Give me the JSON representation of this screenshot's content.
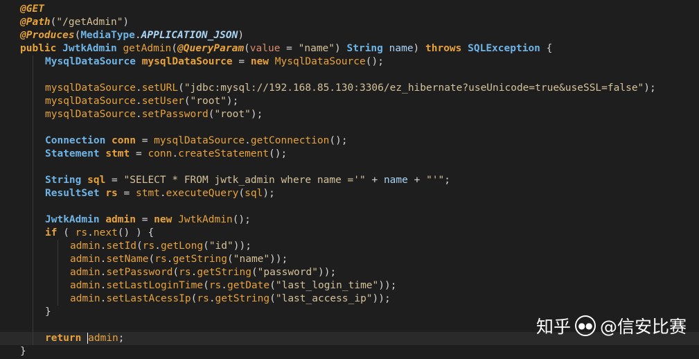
{
  "code": {
    "lines": [
      {
        "indent": 0,
        "tokens": [
          [
            "ann",
            "@GET"
          ]
        ]
      },
      {
        "indent": 0,
        "tokens": [
          [
            "ann",
            "@Path"
          ],
          [
            "pun",
            "("
          ],
          [
            "str",
            "\"/getAdmin\""
          ],
          [
            "pun",
            ")"
          ]
        ]
      },
      {
        "indent": 0,
        "tokens": [
          [
            "ann",
            "@Produces"
          ],
          [
            "pun",
            "("
          ],
          [
            "typ",
            "MediaType"
          ],
          [
            "pun",
            "."
          ],
          [
            "const",
            "APPLICATION_JSON"
          ],
          [
            "pun",
            ")"
          ]
        ]
      },
      {
        "indent": 0,
        "tokens": [
          [
            "kw",
            "public"
          ],
          [
            "plain",
            " "
          ],
          [
            "typ",
            "JwtkAdmin"
          ],
          [
            "plain",
            " "
          ],
          [
            "fn",
            "getAdmin"
          ],
          [
            "pun",
            "("
          ],
          [
            "ann",
            "@QueryParam"
          ],
          [
            "pun",
            "("
          ],
          [
            "param",
            "value"
          ],
          [
            "plain",
            " = "
          ],
          [
            "str",
            "\"name\""
          ],
          [
            "pun",
            ")"
          ],
          [
            "plain",
            " "
          ],
          [
            "typ",
            "String"
          ],
          [
            "plain",
            " "
          ],
          [
            "pvar",
            "name"
          ],
          [
            "pun",
            ")"
          ],
          [
            "plain",
            " "
          ],
          [
            "kw",
            "throws"
          ],
          [
            "plain",
            " "
          ],
          [
            "typ",
            "SQLException"
          ],
          [
            "plain",
            " {"
          ]
        ]
      },
      {
        "indent": 1,
        "tokens": [
          [
            "typ",
            "MysqlDataSource"
          ],
          [
            "plain",
            " "
          ],
          [
            "var",
            "mysqlDataSource"
          ],
          [
            "plain",
            " = "
          ],
          [
            "kw",
            "new"
          ],
          [
            "plain",
            " "
          ],
          [
            "fn",
            "MysqlDataSource"
          ],
          [
            "pun",
            "();"
          ]
        ]
      },
      {
        "indent": 0,
        "tokens": []
      },
      {
        "indent": 1,
        "tokens": [
          [
            "fn",
            "mysqlDataSource"
          ],
          [
            "pun",
            "."
          ],
          [
            "fn",
            "setURL"
          ],
          [
            "pun",
            "("
          ],
          [
            "str",
            "\"jdbc:mysql://192.168.85.130:3306/ez_hibernate?useUnicode=true&useSSL=false\""
          ],
          [
            "pun",
            ");"
          ]
        ]
      },
      {
        "indent": 1,
        "tokens": [
          [
            "fn",
            "mysqlDataSource"
          ],
          [
            "pun",
            "."
          ],
          [
            "fn",
            "setUser"
          ],
          [
            "pun",
            "("
          ],
          [
            "str",
            "\"root\""
          ],
          [
            "pun",
            ");"
          ]
        ]
      },
      {
        "indent": 1,
        "tokens": [
          [
            "fn",
            "mysqlDataSource"
          ],
          [
            "pun",
            "."
          ],
          [
            "fn",
            "setPassword"
          ],
          [
            "pun",
            "("
          ],
          [
            "str",
            "\"root\""
          ],
          [
            "pun",
            ");"
          ]
        ]
      },
      {
        "indent": 0,
        "tokens": []
      },
      {
        "indent": 1,
        "tokens": [
          [
            "typ",
            "Connection"
          ],
          [
            "plain",
            " "
          ],
          [
            "var",
            "conn"
          ],
          [
            "plain",
            " = "
          ],
          [
            "fn",
            "mysqlDataSource"
          ],
          [
            "pun",
            "."
          ],
          [
            "fn",
            "getConnection"
          ],
          [
            "pun",
            "();"
          ]
        ]
      },
      {
        "indent": 1,
        "tokens": [
          [
            "typ",
            "Statement"
          ],
          [
            "plain",
            " "
          ],
          [
            "var",
            "stmt"
          ],
          [
            "plain",
            " = "
          ],
          [
            "fn",
            "conn"
          ],
          [
            "pun",
            "."
          ],
          [
            "fn",
            "createStatement"
          ],
          [
            "pun",
            "();"
          ]
        ]
      },
      {
        "indent": 0,
        "tokens": []
      },
      {
        "indent": 1,
        "tokens": [
          [
            "typ",
            "String"
          ],
          [
            "plain",
            " "
          ],
          [
            "var",
            "sql"
          ],
          [
            "plain",
            " = "
          ],
          [
            "str",
            "\"SELECT * FROM jwtk_admin where name ='\""
          ],
          [
            "plain",
            " + "
          ],
          [
            "pvar",
            "name"
          ],
          [
            "plain",
            " + "
          ],
          [
            "str",
            "\"'\""
          ],
          [
            "pun",
            ";"
          ]
        ]
      },
      {
        "indent": 1,
        "tokens": [
          [
            "typ",
            "ResultSet"
          ],
          [
            "plain",
            " "
          ],
          [
            "var",
            "rs"
          ],
          [
            "plain",
            " = "
          ],
          [
            "fn",
            "stmt"
          ],
          [
            "pun",
            "."
          ],
          [
            "fn",
            "executeQuery"
          ],
          [
            "pun",
            "("
          ],
          [
            "fn",
            "sql"
          ],
          [
            "pun",
            ");"
          ]
        ]
      },
      {
        "indent": 0,
        "tokens": []
      },
      {
        "indent": 1,
        "tokens": [
          [
            "typ",
            "JwtkAdmin"
          ],
          [
            "plain",
            " "
          ],
          [
            "var",
            "admin"
          ],
          [
            "plain",
            " = "
          ],
          [
            "kw",
            "new"
          ],
          [
            "plain",
            " "
          ],
          [
            "fn",
            "JwtkAdmin"
          ],
          [
            "pun",
            "();"
          ]
        ]
      },
      {
        "indent": 1,
        "tokens": [
          [
            "kw",
            "if"
          ],
          [
            "plain",
            " ( "
          ],
          [
            "fn",
            "rs"
          ],
          [
            "pun",
            "."
          ],
          [
            "fn",
            "next"
          ],
          [
            "pun",
            "()"
          ],
          [
            "plain",
            " ) {"
          ]
        ]
      },
      {
        "indent": 2,
        "tokens": [
          [
            "fn",
            "admin"
          ],
          [
            "pun",
            "."
          ],
          [
            "fn",
            "setId"
          ],
          [
            "pun",
            "("
          ],
          [
            "fn",
            "rs"
          ],
          [
            "pun",
            "."
          ],
          [
            "fn",
            "getLong"
          ],
          [
            "pun",
            "("
          ],
          [
            "str",
            "\"id\""
          ],
          [
            "pun",
            "));"
          ]
        ]
      },
      {
        "indent": 2,
        "tokens": [
          [
            "fn",
            "admin"
          ],
          [
            "pun",
            "."
          ],
          [
            "fn",
            "setName"
          ],
          [
            "pun",
            "("
          ],
          [
            "fn",
            "rs"
          ],
          [
            "pun",
            "."
          ],
          [
            "fn",
            "getString"
          ],
          [
            "pun",
            "("
          ],
          [
            "str",
            "\"name\""
          ],
          [
            "pun",
            "));"
          ]
        ]
      },
      {
        "indent": 2,
        "tokens": [
          [
            "fn",
            "admin"
          ],
          [
            "pun",
            "."
          ],
          [
            "fn",
            "setPassword"
          ],
          [
            "pun",
            "("
          ],
          [
            "fn",
            "rs"
          ],
          [
            "pun",
            "."
          ],
          [
            "fn",
            "getString"
          ],
          [
            "pun",
            "("
          ],
          [
            "str",
            "\"password\""
          ],
          [
            "pun",
            "));"
          ]
        ]
      },
      {
        "indent": 2,
        "tokens": [
          [
            "fn",
            "admin"
          ],
          [
            "pun",
            "."
          ],
          [
            "fn",
            "setLastLoginTime"
          ],
          [
            "pun",
            "("
          ],
          [
            "fn",
            "rs"
          ],
          [
            "pun",
            "."
          ],
          [
            "fn",
            "getDate"
          ],
          [
            "pun",
            "("
          ],
          [
            "str",
            "\"last_login_time\""
          ],
          [
            "pun",
            "));"
          ]
        ]
      },
      {
        "indent": 2,
        "tokens": [
          [
            "fn",
            "admin"
          ],
          [
            "pun",
            "."
          ],
          [
            "fn",
            "setLastAcessIp"
          ],
          [
            "pun",
            "("
          ],
          [
            "fn",
            "rs"
          ],
          [
            "pun",
            "."
          ],
          [
            "fn",
            "getString"
          ],
          [
            "pun",
            "("
          ],
          [
            "str",
            "\"last_access_ip\""
          ],
          [
            "pun",
            "));"
          ]
        ]
      },
      {
        "indent": 1,
        "tokens": [
          [
            "plain",
            "}"
          ]
        ]
      },
      {
        "indent": 0,
        "tokens": []
      },
      {
        "indent": 1,
        "current": true,
        "tokens": [
          [
            "kw",
            "return"
          ],
          [
            "plain",
            " "
          ],
          [
            "caret",
            ""
          ],
          [
            "fn",
            "admin"
          ],
          [
            "pun",
            ";"
          ]
        ]
      },
      {
        "indent": 0,
        "tokens": [
          [
            "plain",
            "}"
          ]
        ]
      }
    ]
  },
  "watermark": {
    "site": "知乎",
    "icon": "wechat-icon",
    "author": "@信安比赛"
  },
  "colors": {
    "background": "#1e1e1e",
    "current_line": "#2a2a2a",
    "annotation": "#e8a33a",
    "type": "#6fb4e6",
    "string": "#d6c29a"
  }
}
